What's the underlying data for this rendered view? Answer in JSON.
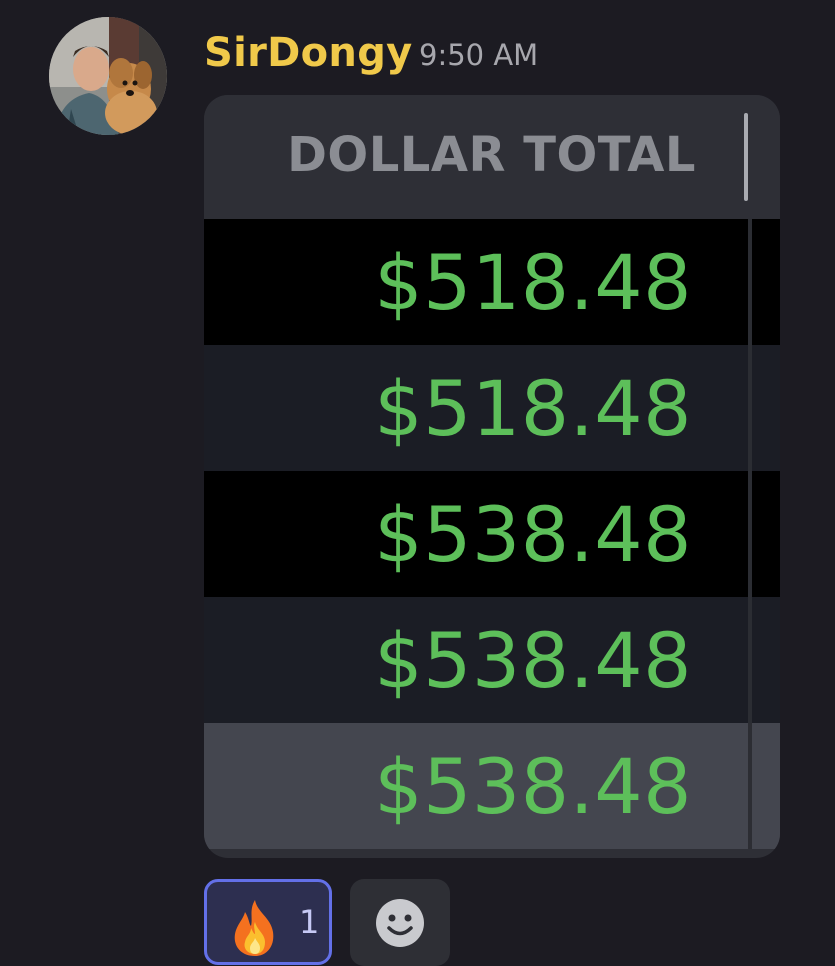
{
  "message": {
    "author": "SirDongy",
    "timestamp": "9:50 AM",
    "author_color": "#f0c94a"
  },
  "table": {
    "header": "DOLLAR TOTAL",
    "rows": [
      {
        "value": "$518.48"
      },
      {
        "value": "$518.48"
      },
      {
        "value": "$538.48"
      },
      {
        "value": "$538.48"
      },
      {
        "value": "$538.48"
      }
    ],
    "value_color": "#5dbf5a"
  },
  "reactions": [
    {
      "emoji": "fire-icon",
      "count": "1",
      "active": true
    }
  ],
  "add_reaction": {
    "icon": "smiley-icon"
  }
}
